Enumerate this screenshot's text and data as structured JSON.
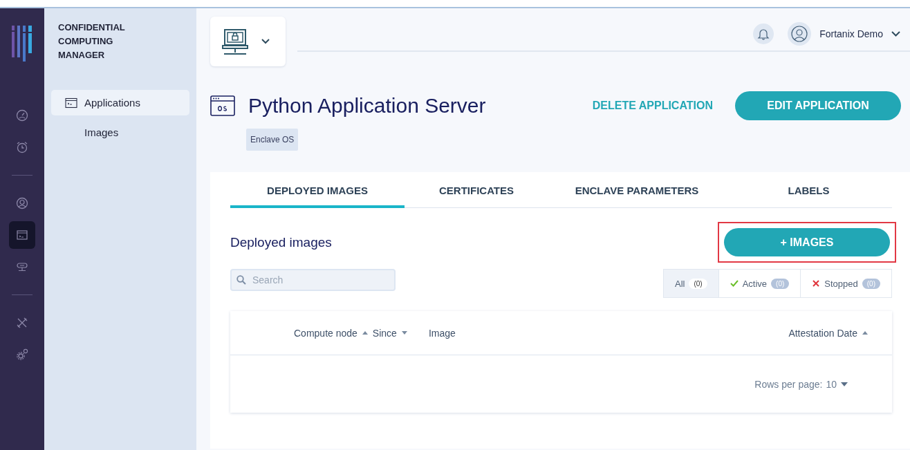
{
  "rail": {
    "items": [
      {
        "kind": "dashboard",
        "selected": false
      },
      {
        "kind": "alarm",
        "selected": false
      },
      {
        "kind": "divider"
      },
      {
        "kind": "user",
        "selected": false
      },
      {
        "kind": "application",
        "selected": true
      },
      {
        "kind": "node",
        "selected": false
      },
      {
        "kind": "divider"
      },
      {
        "kind": "tools",
        "selected": false
      },
      {
        "kind": "settings",
        "selected": false
      }
    ]
  },
  "nav": {
    "title": "CONFIDENTIAL COMPUTING MANAGER",
    "items": [
      {
        "label": "Applications",
        "selected": true,
        "icon": true
      },
      {
        "label": "Images",
        "selected": false,
        "icon": false
      }
    ]
  },
  "header": {
    "user": "Fortanix Demo"
  },
  "application": {
    "title": "Python Application Server",
    "tag": "Enclave OS",
    "delete": "DELETE APPLICATION",
    "edit": "EDIT APPLICATION"
  },
  "tabs": [
    {
      "label": "DEPLOYED IMAGES",
      "selected": true
    },
    {
      "label": "CERTIFICATES",
      "selected": false
    },
    {
      "label": "ENCLAVE PARAMETERS",
      "selected": false
    },
    {
      "label": "LABELS",
      "selected": false
    }
  ],
  "section": {
    "title": "Deployed images",
    "add_button": {
      "label": "+ IMAGES",
      "highlighted": true
    }
  },
  "search": {
    "placeholder": "Search"
  },
  "filters": [
    {
      "kind": "all",
      "label": "All",
      "count": "(0)",
      "selected": true
    },
    {
      "kind": "active",
      "label": "Active",
      "count": "(0)",
      "selected": false
    },
    {
      "kind": "stopped",
      "label": "Stopped",
      "count": "(0)",
      "selected": false
    }
  ],
  "table": {
    "columns": [
      {
        "label": "Compute node",
        "sorted": true,
        "ascending": true
      },
      {
        "label": "Since",
        "sorted": true,
        "ascending": false
      },
      {
        "label": "Image",
        "sorted": false
      },
      {
        "label": "Attestation Date",
        "sorted": true,
        "ascending": true
      }
    ],
    "footer": {
      "label": "Rows per page:",
      "value": "10"
    }
  }
}
